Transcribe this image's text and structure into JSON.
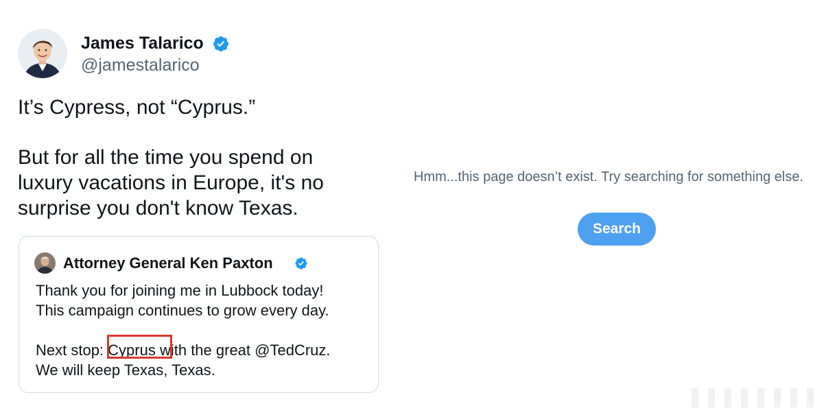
{
  "tweet": {
    "author_name": "James Talarico",
    "author_handle": "@jamestalarico",
    "verified_icon": "verified-badge-icon",
    "paragraphs": [
      "It’s Cypress, not “Cyprus.”",
      "But for all the time you spend on\nluxury vacations in Europe, it's no\nsurprise you don't know Texas."
    ]
  },
  "quoted_tweet": {
    "author_name": "Attorney General Ken Paxton",
    "verified_icon": "verified-badge-icon",
    "paragraphs": [
      "Thank you for joining me in Lubbock today!\nThis campaign continues to grow every day.",
      "Next stop: Cyprus with the great @TedCruz.\nWe will keep Texas, Texas."
    ],
    "highlighted_word": "Cyprus",
    "highlight_color": "#d9382c"
  },
  "error_page": {
    "message": "Hmm...this page doesn’t exist. Try searching for something else.",
    "search_button_label": "Search",
    "button_color": "#4d9ff0"
  },
  "colors": {
    "text_primary": "#0f1419",
    "text_secondary": "#536471",
    "verified_blue": "#1d9bf0",
    "card_border": "#cfd9de"
  }
}
